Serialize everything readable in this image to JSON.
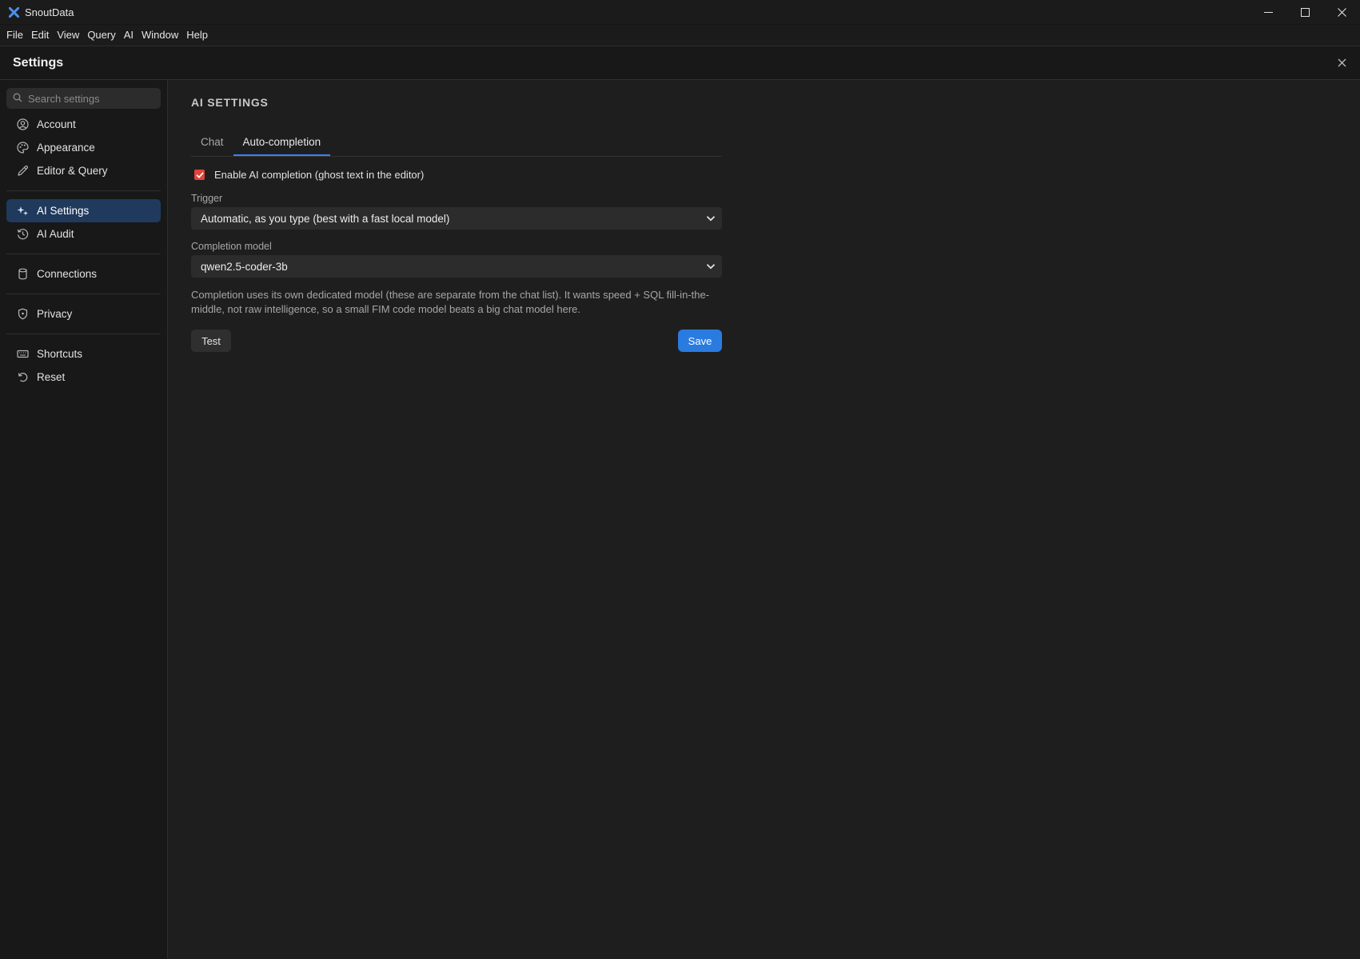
{
  "window": {
    "title": "SnoutData",
    "icon": "snoutdata-logo-icon",
    "controls": [
      "minimize-icon",
      "maximize-icon",
      "close-icon"
    ]
  },
  "menubar": {
    "items": [
      "File",
      "Edit",
      "View",
      "Query",
      "AI",
      "Window",
      "Help"
    ]
  },
  "settings": {
    "title": "Settings",
    "close_icon": "close-icon"
  },
  "sidebar": {
    "search_placeholder": "Search settings",
    "items": [
      {
        "label": "Account",
        "icon": "account-circle-icon"
      },
      {
        "label": "Appearance",
        "icon": "palette-icon"
      },
      {
        "label": "Editor & Query",
        "icon": "pencil-icon"
      },
      {
        "label": "AI Settings",
        "icon": "sparkles-icon",
        "active": true
      },
      {
        "label": "AI Audit",
        "icon": "history-icon"
      },
      {
        "label": "Connections",
        "icon": "database-icon"
      },
      {
        "label": "Privacy",
        "icon": "shield-icon"
      },
      {
        "label": "Shortcuts",
        "icon": "keyboard-icon"
      },
      {
        "label": "Reset",
        "icon": "undo-icon"
      }
    ]
  },
  "main": {
    "section_title": "AI SETTINGS",
    "tabs": [
      {
        "label": "Chat",
        "active": false
      },
      {
        "label": "Auto-completion",
        "active": true
      }
    ],
    "enable_completion": {
      "label": "Enable AI completion (ghost text in the editor)",
      "checked": true
    },
    "trigger": {
      "label": "Trigger",
      "value": "Automatic, as you type (best with a fast local model)"
    },
    "completion_model": {
      "label": "Completion model",
      "value": "qwen2.5-coder-3b"
    },
    "help_text": "Completion uses its own dedicated model (these are separate from the chat list). It wants speed + SQL fill-in-the-middle, not raw intelligence, so a small FIM code model beats a big chat model here.",
    "buttons": {
      "test": "Test",
      "save": "Save"
    }
  },
  "colors": {
    "accent": "#3b82f6",
    "save_button": "#2a7be0",
    "active_nav": "#1f3a5c",
    "checkbox": "#e0443a",
    "background": "#1e1e1e",
    "sidebar": "#181818"
  }
}
